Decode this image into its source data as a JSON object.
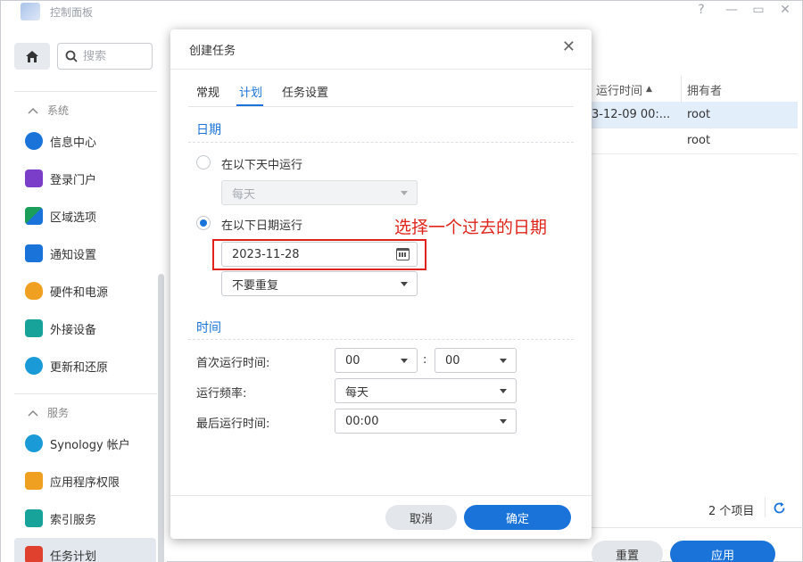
{
  "window": {
    "title": "控制面板",
    "controls": [
      "?",
      "—",
      "▭",
      "✕"
    ]
  },
  "sidebar": {
    "search_placeholder": "搜索",
    "sections": [
      {
        "label": "系统"
      },
      {
        "label": "服务"
      }
    ],
    "items": [
      {
        "label": "信息中心",
        "icon": "info-icon",
        "color": "#1a73d9"
      },
      {
        "label": "登录门户",
        "icon": "portal-icon",
        "color": "#7a3ec8"
      },
      {
        "label": "区域选项",
        "icon": "region-icon",
        "color": "#1b9e5a"
      },
      {
        "label": "通知设置",
        "icon": "notification-icon",
        "color": "#1a73d9"
      },
      {
        "label": "硬件和电源",
        "icon": "bulb-icon",
        "color": "#f0a020"
      },
      {
        "label": "外接设备",
        "icon": "external-device-icon",
        "color": "#17a39a"
      },
      {
        "label": "更新和还原",
        "icon": "update-icon",
        "color": "#1a9ad6"
      },
      {
        "label": "Synology 帐户",
        "icon": "account-icon",
        "color": "#1a9ad6"
      },
      {
        "label": "应用程序权限",
        "icon": "lock-icon",
        "color": "#f0a020"
      },
      {
        "label": "索引服务",
        "icon": "index-icon",
        "color": "#17a39a"
      },
      {
        "label": "任务计划",
        "icon": "calendar-icon",
        "color": "#e0412f"
      }
    ]
  },
  "background": {
    "columns": [
      "运行时间",
      "拥有者"
    ],
    "rows": [
      {
        "time": "3-12-09 00:...",
        "owner": "root"
      },
      {
        "time": "",
        "owner": "root"
      }
    ],
    "item_count": "2 个项目",
    "reset_label": "重置",
    "apply_label": "应用"
  },
  "dialog": {
    "title": "创建任务",
    "tabs": [
      "常规",
      "计划",
      "任务设置"
    ],
    "active_tab": "计划",
    "date_group": {
      "title": "日期",
      "option_daily": "在以下天中运行",
      "daily_select": "每天",
      "option_date": "在以下日期运行",
      "date_value": "2023-11-28",
      "repeat_select": "不要重复"
    },
    "time_group": {
      "title": "时间",
      "first_run_label": "首次运行时间:",
      "first_run_hour": "00",
      "first_run_minute": "00",
      "frequency_label": "运行频率:",
      "frequency_value": "每天",
      "last_run_label": "最后运行时间:",
      "last_run_value": "00:00"
    },
    "cancel_label": "取消",
    "ok_label": "确定"
  },
  "annotation": {
    "text": "选择一个过去的日期",
    "color": "#e0241b"
  }
}
